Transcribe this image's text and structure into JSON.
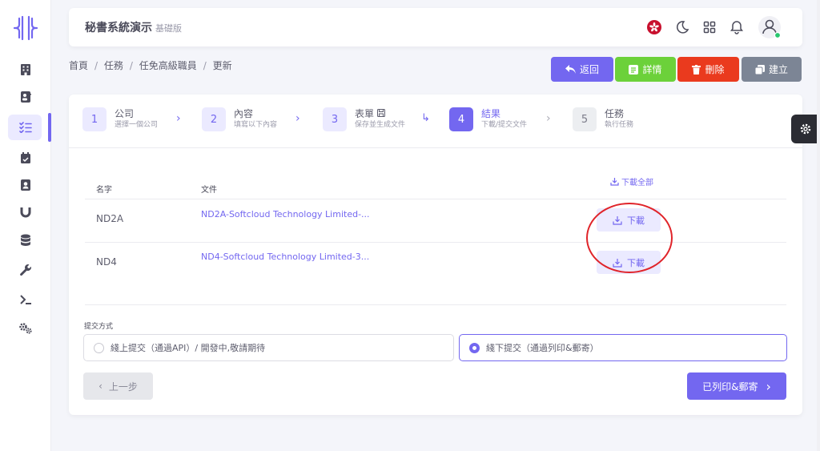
{
  "app": {
    "title": "秘書系統演示",
    "edition": "基礎版"
  },
  "sidebar": {
    "items": [
      {
        "icon": "building-icon"
      },
      {
        "icon": "contact-card-icon"
      },
      {
        "icon": "task-list-icon",
        "active": true
      },
      {
        "icon": "calendar-check-icon"
      },
      {
        "icon": "address-book-icon"
      },
      {
        "icon": "magnet-icon"
      },
      {
        "icon": "database-icon"
      },
      {
        "icon": "wrench-icon"
      },
      {
        "icon": "terminal-icon"
      },
      {
        "icon": "gears-icon"
      }
    ]
  },
  "header_icons": [
    "hong-kong-flag-icon",
    "moon-icon",
    "grid-icon",
    "bell-icon",
    "user-avatar-icon"
  ],
  "breadcrumb": [
    "首頁",
    "任務",
    "任免高級職員",
    "更新"
  ],
  "actions": {
    "back": "返回",
    "detail": "詳情",
    "delete": "刪除",
    "create": "建立"
  },
  "stepper": [
    {
      "num": "1",
      "title": "公司",
      "sub": "選擇一個公司"
    },
    {
      "num": "2",
      "title": "內容",
      "sub": "填寫以下內容"
    },
    {
      "num": "3",
      "title": "表單",
      "sub": "保存並生成文件"
    },
    {
      "num": "4",
      "title": "結果",
      "sub": "下載/提交文件"
    },
    {
      "num": "5",
      "title": "任務",
      "sub": "執行任務"
    }
  ],
  "table": {
    "headers": {
      "name": "名字",
      "file": "文件"
    },
    "download_all": "下載全部",
    "rows": [
      {
        "name": "ND2A",
        "file": "ND2A-Softcloud Technology Limited-...",
        "action": "下載"
      },
      {
        "name": "ND4",
        "file": "ND4-Softcloud Technology Limited-3...",
        "action": "下載"
      }
    ]
  },
  "submission": {
    "label": "提交方式",
    "options": [
      {
        "text": "綫上提交（通過API）/ 開發中,敬請期待",
        "selected": false
      },
      {
        "text": "綫下提交（通過列印&郵寄）",
        "selected": true
      }
    ]
  },
  "nav_buttons": {
    "prev": "上一步",
    "next": "已列印&郵寄"
  },
  "colors": {
    "primary": "#7367f0",
    "success": "#6cd13a",
    "danger": "#ea3a1e",
    "secondary": "#7c8595",
    "annotation": "#e0242a"
  }
}
